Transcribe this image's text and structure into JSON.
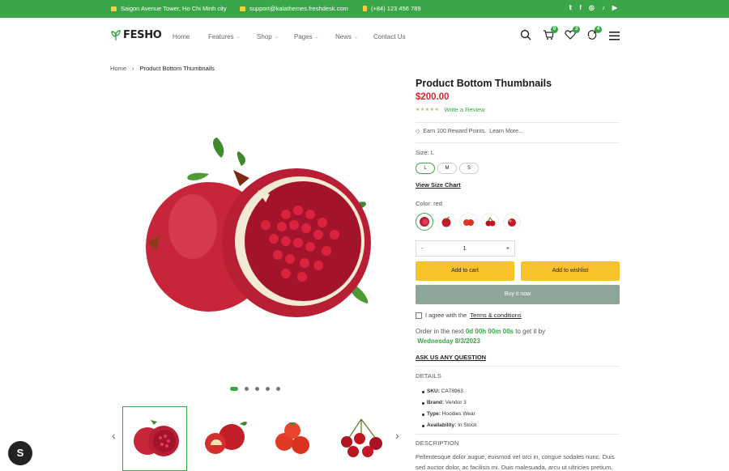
{
  "topbar": {
    "address": "Saigon Avenue Tower, Ho Chi Minh city",
    "email": "support@kalathemes.freshdesk.com",
    "phone": "(+84) 123 456 789",
    "social": [
      "twitter-icon",
      "facebook-icon",
      "instagram-icon",
      "tiktok-icon",
      "youtube-icon"
    ]
  },
  "header": {
    "logo": "FESHO",
    "nav": [
      {
        "label": "Home",
        "dropdown": false
      },
      {
        "label": "Features",
        "dropdown": true
      },
      {
        "label": "Shop",
        "dropdown": true
      },
      {
        "label": "Pages",
        "dropdown": true
      },
      {
        "label": "News",
        "dropdown": true
      },
      {
        "label": "Contact Us",
        "dropdown": false
      }
    ],
    "cart_count": "0",
    "wishlist_count": "3",
    "compare_count": "4"
  },
  "breadcrumb": {
    "home": "Home",
    "sep": "›",
    "current": "Product Bottom Thumbnails"
  },
  "gallery": {
    "slides": 5,
    "active_slide": 1,
    "thumbs": [
      "Pomegranate",
      "Apples",
      "Tomatoes",
      "Cherries"
    ]
  },
  "product": {
    "title": "Product Bottom Thumbnails",
    "price": "$200.00",
    "stars": "★★★★★",
    "write_review": "Write a Review",
    "reward": "Earn 100 Reward Points.",
    "learn_more": "Learn More...",
    "size_label": "Size: L",
    "sizes": [
      "L",
      "M",
      "S"
    ],
    "size_chart": "View Size Chart",
    "color_label": "Color: red",
    "qty_minus": "-",
    "qty_value": "1",
    "qty_plus": "+",
    "add_to_cart": "Add to cart",
    "add_to_wishlist": "Add to wishlist",
    "buy_now": "Buy it now",
    "agree_text": "I agree with the",
    "terms": "Terms & conditions",
    "order_prefix": "Order in the next",
    "order_time": "0d 00h 00m 00s",
    "order_mid": "to get it by",
    "order_date": "Wednesday 8/3/2023",
    "ask": "ASK US ANY QUESTION",
    "details_title": "DETAILS",
    "details": [
      {
        "k": "SKU:",
        "v": "CA78963"
      },
      {
        "k": "Brand:",
        "v": "Vendor 3"
      },
      {
        "k": "Type:",
        "v": "Hoodies Wear"
      },
      {
        "k": "Availability:",
        "v": "In Stock"
      }
    ],
    "desc_title": "DESCRIPTION",
    "description": "Pellentesque dolor augue, euismod vel orci in, congue sodales nunc. Duis sed auctor dolor, ac facilisis mi. Duis malesuada, arcu ut ultricies pretium,"
  },
  "colors": {
    "accent": "#3ba54a",
    "price": "#d6262e",
    "button": "#f8c32a",
    "buy": "#8ea69a"
  }
}
